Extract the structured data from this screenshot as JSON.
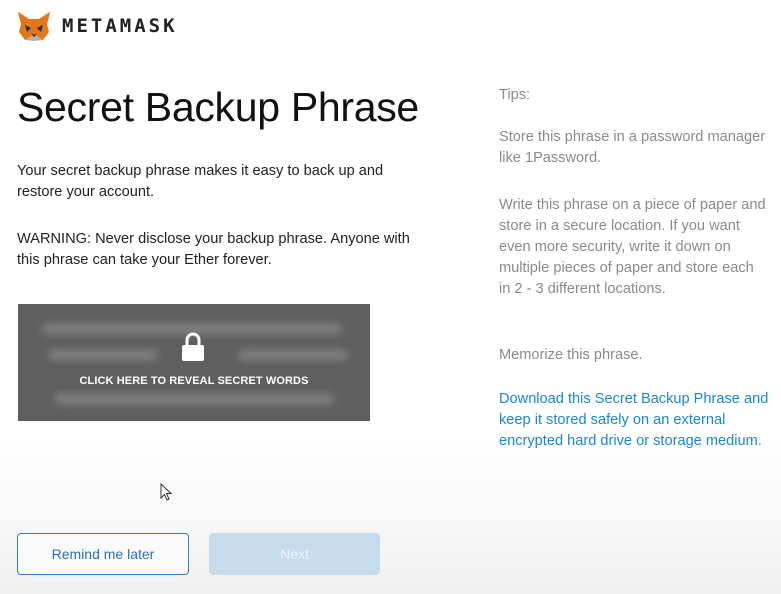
{
  "header": {
    "brand": "METAMASK",
    "logo_icon": "metamask-fox-icon"
  },
  "main": {
    "title": "Secret Backup Phrase",
    "description": "Your secret backup phrase makes it easy to back up and restore your account.",
    "warning": "WARNING: Never disclose your backup phrase. Anyone with this phrase can take your Ether forever.",
    "reveal_label": "CLICK HERE TO REVEAL SECRET WORDS",
    "reveal_icon": "lock-icon"
  },
  "tips": {
    "title": "Tips:",
    "tip1": "Store this phrase in a password manager like 1Password.",
    "tip2": "Write this phrase on a piece of paper and store in a secure location. If you want even more security, write it down on multiple pieces of paper and store each in 2 - 3 different locations.",
    "tip3": "Memorize this phrase.",
    "download_link": "Download this Secret Backup Phrase and keep it stored safely on an external encrypted hard drive or storage medium."
  },
  "buttons": {
    "remind_label": "Remind me later",
    "next_label": "Next",
    "next_disabled": true
  },
  "colors": {
    "accent": "#2f80c8",
    "link": "#1a86d6",
    "reveal_bg": "#5f5f5f",
    "next_disabled_bg": "#c6dced"
  }
}
